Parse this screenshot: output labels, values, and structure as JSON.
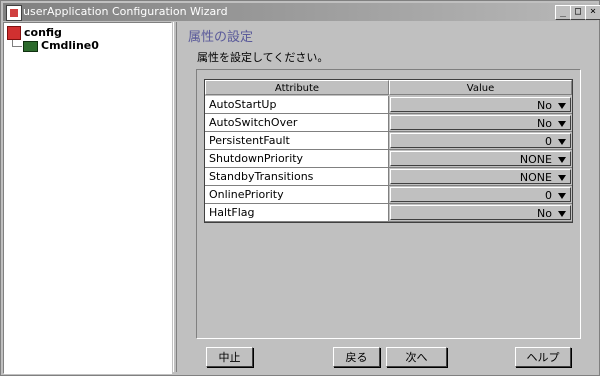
{
  "window": {
    "title": "userApplication Configuration Wizard",
    "controls": {
      "minimize": "_",
      "maximize": "□",
      "close": "×"
    }
  },
  "tree": {
    "root": {
      "label": "config",
      "icon": "config-icon"
    },
    "child": {
      "label": "Cmdline0",
      "icon": "cmdline-resource-icon"
    }
  },
  "panel": {
    "title": "属性の設定",
    "description": "属性を設定してください。"
  },
  "table": {
    "headers": {
      "attribute": "Attribute",
      "value": "Value"
    },
    "rows": [
      {
        "attribute": "AutoStartUp",
        "value": "No"
      },
      {
        "attribute": "AutoSwitchOver",
        "value": "No"
      },
      {
        "attribute": "PersistentFault",
        "value": "0"
      },
      {
        "attribute": "ShutdownPriority",
        "value": "NONE"
      },
      {
        "attribute": "StandbyTransitions",
        "value": "NONE"
      },
      {
        "attribute": "OnlinePriority",
        "value": "0"
      },
      {
        "attribute": "HaltFlag",
        "value": "No"
      }
    ]
  },
  "buttons": {
    "cancel": "中止",
    "back": "戻る",
    "next": "次へ",
    "help": "ヘルプ"
  }
}
